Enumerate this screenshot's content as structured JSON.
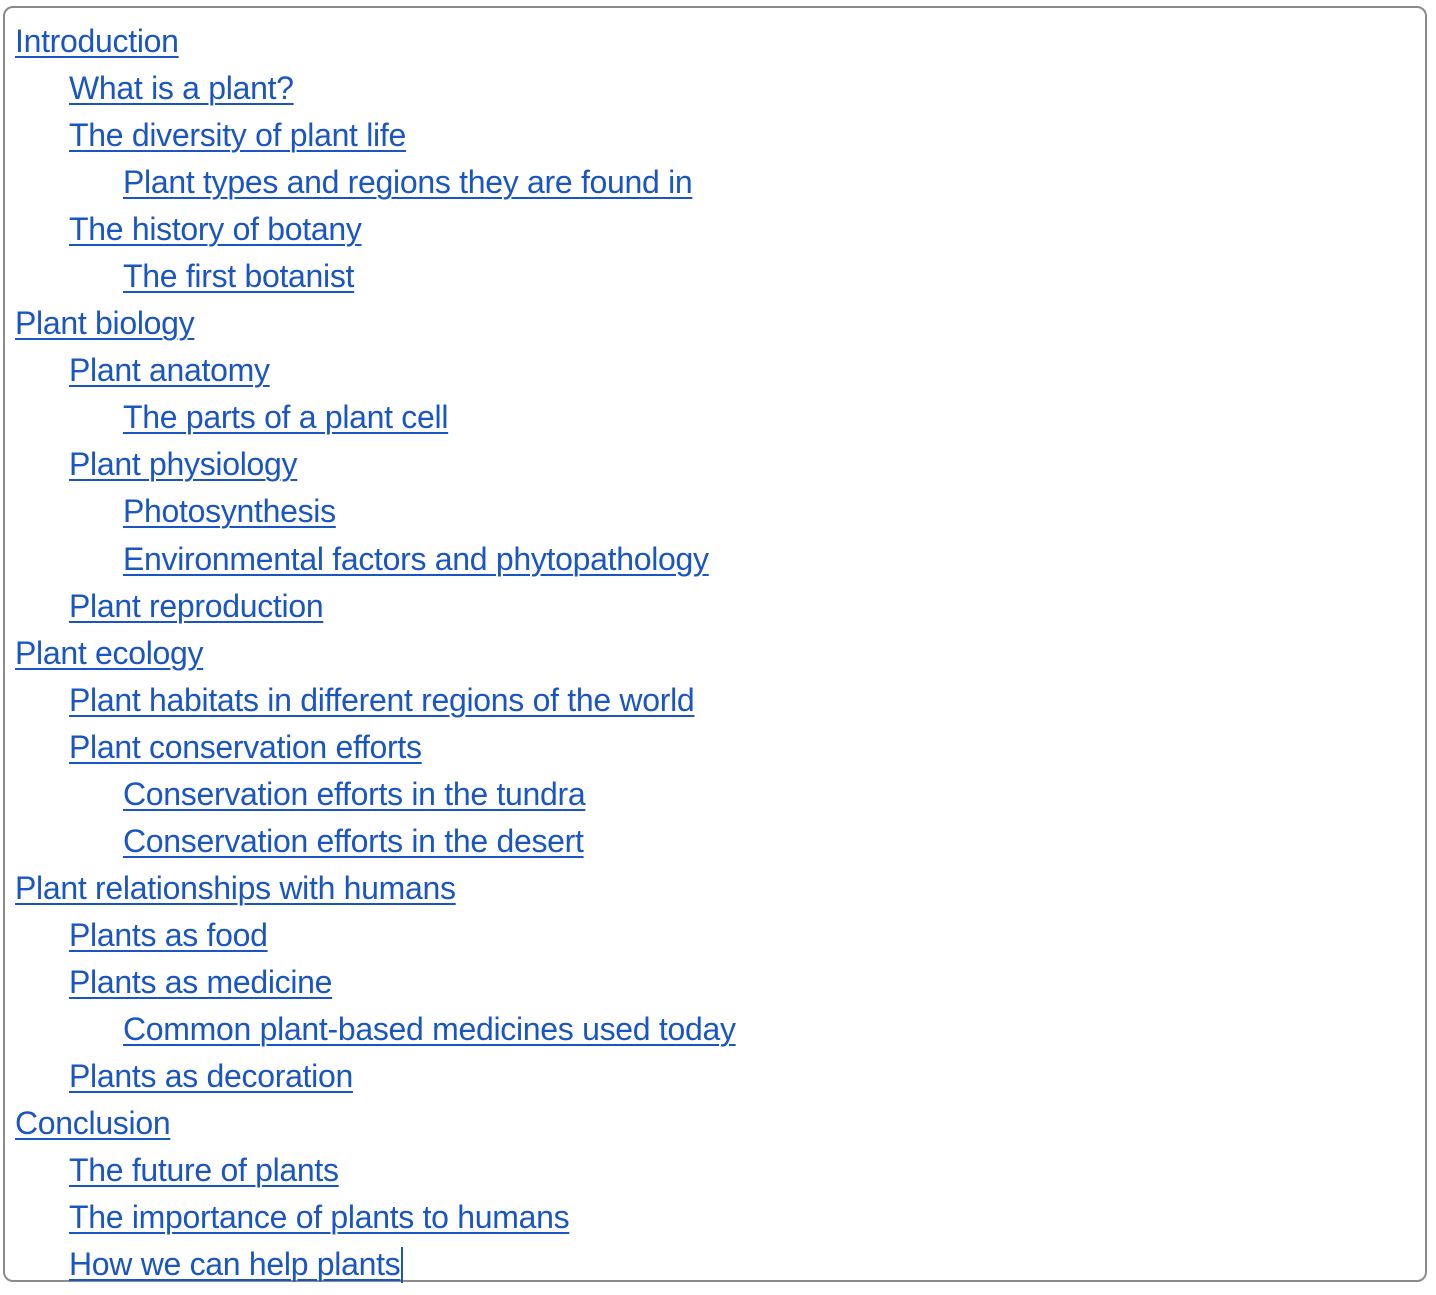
{
  "toc": {
    "items": [
      {
        "label": "Introduction",
        "level": 0
      },
      {
        "label": "What is a plant?",
        "level": 1
      },
      {
        "label": "The diversity of plant life",
        "level": 1
      },
      {
        "label": "Plant types and regions they are found in",
        "level": 2
      },
      {
        "label": "The history of botany",
        "level": 1
      },
      {
        "label": "The first botanist",
        "level": 2
      },
      {
        "label": "Plant biology",
        "level": 0
      },
      {
        "label": "Plant anatomy",
        "level": 1
      },
      {
        "label": "The parts of a plant cell",
        "level": 2
      },
      {
        "label": "Plant physiology",
        "level": 1
      },
      {
        "label": "Photosynthesis",
        "level": 2
      },
      {
        "label": "Environmental factors and phytopathology",
        "level": 2
      },
      {
        "label": "Plant reproduction",
        "level": 1
      },
      {
        "label": "Plant ecology",
        "level": 0
      },
      {
        "label": "Plant habitats in different regions of the world",
        "level": 1
      },
      {
        "label": "Plant conservation efforts",
        "level": 1
      },
      {
        "label": "Conservation efforts in the tundra",
        "level": 2
      },
      {
        "label": "Conservation efforts in the desert",
        "level": 2
      },
      {
        "label": "Plant relationships with humans",
        "level": 0
      },
      {
        "label": "Plants as food",
        "level": 1
      },
      {
        "label": "Plants as medicine",
        "level": 1
      },
      {
        "label": "Common plant-based medicines used today",
        "level": 2
      },
      {
        "label": "Plants as decoration",
        "level": 1
      },
      {
        "label": "Conclusion",
        "level": 0
      },
      {
        "label": "The future of plants",
        "level": 1
      },
      {
        "label": "The importance of plants to humans",
        "level": 1
      },
      {
        "label": "How we can help plants",
        "level": 1
      }
    ]
  },
  "colors": {
    "link": "#1a55c4",
    "border": "#8a8a8a"
  }
}
